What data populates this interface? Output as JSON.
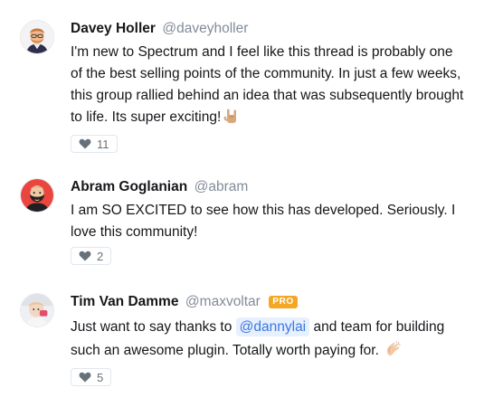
{
  "messages": [
    {
      "author": "Davey Holler",
      "handle": "@daveyholler",
      "lines": [
        "I'm new to Spectrum and I feel like this thread is probably one",
        "of the best selling points of the community. In just a few weeks,",
        "this group rallied behind an idea that was subsequently brought",
        "to life. Its super exciting!"
      ],
      "emoji": "rock-on-hand-emoji",
      "reaction_count": "11"
    },
    {
      "author": "Abram Goglanian",
      "handle": "@abram",
      "lines": [
        "I am SO EXCITED to see how this has developed. Seriously. I",
        "love this community!"
      ],
      "reaction_count": "2"
    },
    {
      "author": "Tim Van Damme",
      "handle": "@maxvoltar",
      "badge": "PRO",
      "line1_prefix": "Just want to say thanks to ",
      "mention": "@dannylai",
      "line1_suffix": " and team for building",
      "line2": "such an awesome plugin. Totally worth paying for.",
      "emoji": "clapping-hands-emoji",
      "reaction_count": "5"
    }
  ],
  "icons": {
    "reaction": "heart-icon"
  },
  "colors": {
    "mention_bg": "#e6f0ff",
    "mention_text": "#3b77e0",
    "pro_badge": "#f5a623",
    "handle": "#828c99",
    "reaction_border": "#dfe7ef"
  }
}
